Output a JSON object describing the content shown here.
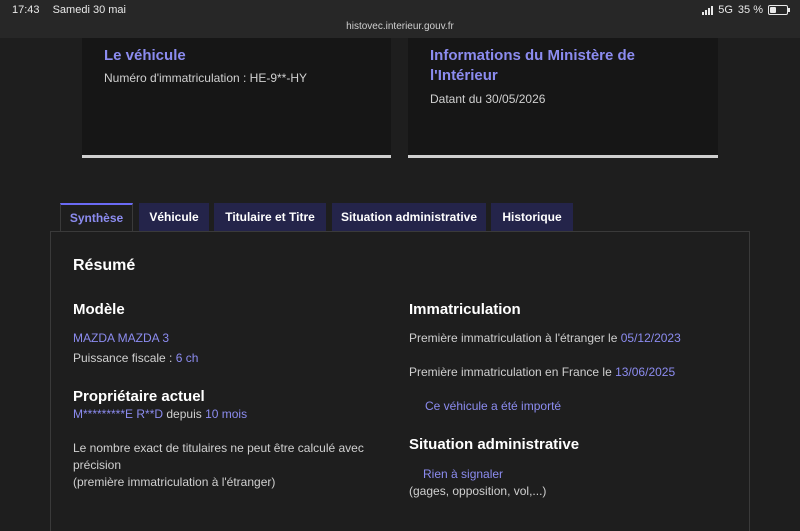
{
  "status_bar": {
    "time": "17:43",
    "date": "Samedi 30 mai",
    "network": "5G",
    "battery": "35 %",
    "battery_level": 0.35
  },
  "browser": {
    "url": "histovec.interieur.gouv.fr"
  },
  "cards": {
    "vehicle": {
      "title": "Le véhicule",
      "plate_label": "Numéro d'immatriculation : ",
      "plate_value": "HE-9**-HY"
    },
    "ministry": {
      "title": "Informations du Ministère de l'Intérieur",
      "date_label": "Datant du ",
      "date_value": "30/05/2026"
    }
  },
  "tabs": [
    {
      "label": "Synthèse",
      "active": true
    },
    {
      "label": "Véhicule",
      "active": false
    },
    {
      "label": "Titulaire et Titre",
      "active": false
    },
    {
      "label": "Situation administrative",
      "active": false
    },
    {
      "label": "Historique",
      "active": false
    }
  ],
  "summary": {
    "title": "Résumé",
    "model": {
      "heading": "Modèle",
      "name": "MAZDA MAZDA 3",
      "power_label": "Puissance fiscale : ",
      "power_value": "6 ch"
    },
    "owner": {
      "heading": "Propriétaire actuel",
      "name": "M*********E R**D",
      "since_label": " depuis ",
      "since_value": "10 mois",
      "note_line1": "Le nombre exact de titulaires ne peut être calculé avec",
      "note_line2": "précision",
      "note_line3": "(première immatriculation à l'étranger)"
    },
    "registration": {
      "heading": "Immatriculation",
      "foreign_label": "Première immatriculation à l'étranger le ",
      "foreign_date": "05/12/2023",
      "france_label": "Première immatriculation en France le ",
      "france_date": "13/06/2025",
      "imported_text": "Ce véhicule a été importé"
    },
    "admin": {
      "heading": "Situation administrative",
      "status": "Rien à signaler",
      "details": "(gages, opposition, vol,...)"
    }
  }
}
